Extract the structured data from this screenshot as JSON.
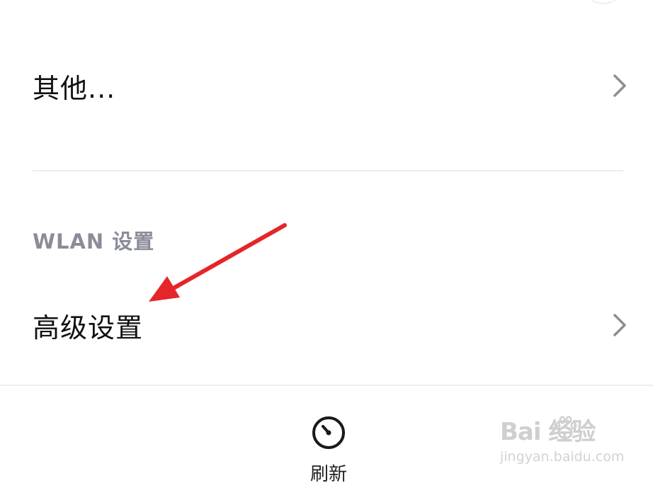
{
  "list": {
    "other_label": "其他...",
    "section_header": "WLAN 设置",
    "advanced_label": "高级设置"
  },
  "bottom_bar": {
    "refresh_label": "刷新"
  },
  "watermark": {
    "brand": "Bai 经验",
    "url": "jingyan.baidu.com"
  },
  "icons": {
    "chevron": "chevron-right-icon",
    "refresh": "refresh-icon",
    "annotation": "red-arrow-annotation"
  },
  "colors": {
    "annotation_red": "#e5252a",
    "section_header": "#8a8d98"
  }
}
